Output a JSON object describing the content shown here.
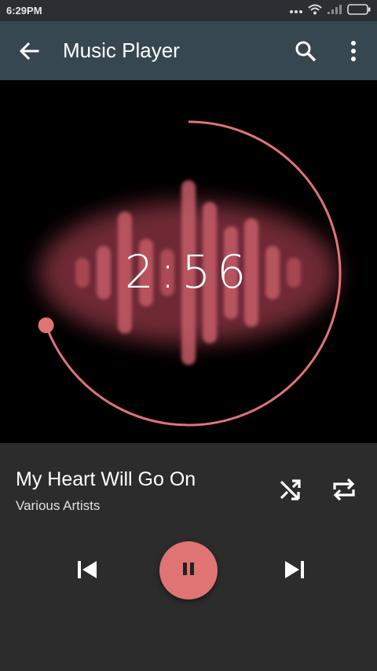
{
  "status": {
    "time": "6:29PM",
    "icons": [
      "more-dots-icon",
      "wifi-icon",
      "signal-icon",
      "battery-icon"
    ]
  },
  "appbar": {
    "title": "Music Player",
    "back_icon": "arrow-back-icon",
    "search_icon": "search-icon",
    "menu_icon": "more-vert-icon"
  },
  "player": {
    "elapsed": "2:56",
    "accent": "#e07474",
    "song_title": "My Heart Will Go On",
    "artist": "Various Artists",
    "controls": [
      "shuffle-icon",
      "repeat-icon",
      "skip-previous-icon",
      "pause-icon",
      "skip-next-icon"
    ]
  }
}
